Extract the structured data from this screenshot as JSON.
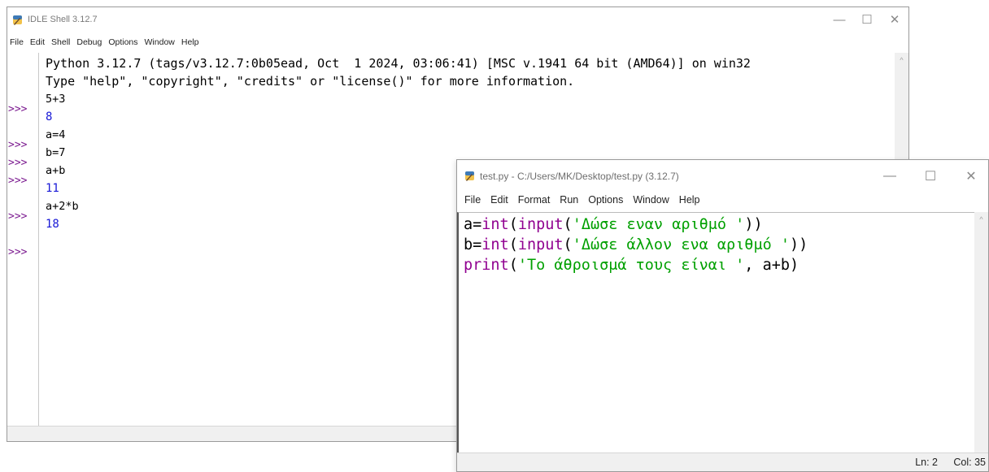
{
  "shell": {
    "title": "IDLE Shell 3.12.7",
    "menu": [
      "File",
      "Edit",
      "Shell",
      "Debug",
      "Options",
      "Window",
      "Help"
    ],
    "banner": [
      "Python 3.12.7 (tags/v3.12.7:0b05ead, Oct  1 2024, 03:06:41) [MSC v.1941 64 bit (AMD64)] on win32",
      "Type \"help\", \"copyright\", \"credits\" or \"license()\" for more information."
    ],
    "prompt": ">>>",
    "session": [
      {
        "kind": "cmd",
        "text": "5+3"
      },
      {
        "kind": "out",
        "text": "8"
      },
      {
        "kind": "cmd",
        "text": "a=4"
      },
      {
        "kind": "cmd",
        "text": "b=7"
      },
      {
        "kind": "cmd",
        "text": "a+b"
      },
      {
        "kind": "out",
        "text": "11"
      },
      {
        "kind": "cmd",
        "text": "a+2*b"
      },
      {
        "kind": "out",
        "text": "18"
      },
      {
        "kind": "cmd",
        "text": ""
      }
    ],
    "window_controls": {
      "minimize": "—",
      "maximize": "☐",
      "close": "✕"
    }
  },
  "editor": {
    "title": "test.py - C:/Users/MK/Desktop/test.py (3.12.7)",
    "menu": [
      "File",
      "Edit",
      "Format",
      "Run",
      "Options",
      "Window",
      "Help"
    ],
    "code": [
      {
        "pre": "a=",
        "builtin1": "int",
        "mid1": "(",
        "builtin2": "input",
        "mid2": "(",
        "string": "'Δώσε εναν αριθμό '",
        "post": "))"
      },
      {
        "pre": "b=",
        "builtin1": "int",
        "mid1": "(",
        "builtin2": "input",
        "mid2": "(",
        "string": "'Δώσε άλλον ενα αριθμό '",
        "post": "))"
      },
      {
        "pre": "",
        "builtin1": "print",
        "mid1": "(",
        "builtin2": "",
        "mid2": "",
        "string": "'Το άθροισμά τους είναι '",
        "post": ", a+b)"
      }
    ],
    "status": {
      "ln": "Ln: 2",
      "col": "Col: 35"
    },
    "window_controls": {
      "minimize": "—",
      "maximize": "☐",
      "close": "✕"
    }
  },
  "colors": {
    "prompt": "#7d1d91",
    "output": "#1818d6",
    "builtin": "#900090",
    "string": "#00a000"
  }
}
